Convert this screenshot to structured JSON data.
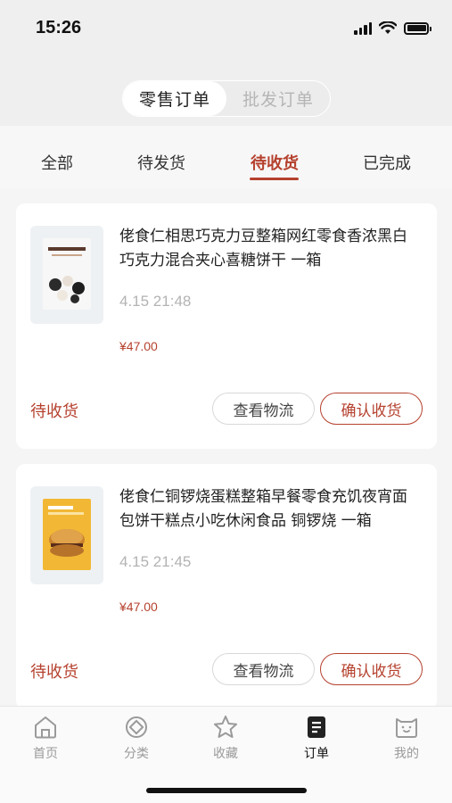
{
  "status_bar": {
    "time": "15:26"
  },
  "segmented": {
    "retail": "零售订单",
    "wholesale": "批发订单"
  },
  "tabs": [
    {
      "label": "全部"
    },
    {
      "label": "待发货"
    },
    {
      "label": "待收货"
    },
    {
      "label": "已完成"
    }
  ],
  "orders": [
    {
      "title": "佬食仁相思巧克力豆整箱网红零食香浓黑白巧克力混合夹心喜糖饼干 一箱",
      "date": "4.15 21:48",
      "price": "¥47.00",
      "status": "待收货",
      "btn_logistics": "查看物流",
      "btn_confirm": "确认收货"
    },
    {
      "title": "佬食仁铜锣烧蛋糕整箱早餐零食充饥夜宵面包饼干糕点小吃休闲食品 铜锣烧 一箱",
      "date": "4.15 21:45",
      "price": "¥47.00",
      "status": "待收货",
      "btn_logistics": "查看物流",
      "btn_confirm": "确认收货"
    }
  ],
  "bottom_nav": [
    {
      "label": "首页",
      "icon": "home-icon"
    },
    {
      "label": "分类",
      "icon": "category-icon"
    },
    {
      "label": "收藏",
      "icon": "star-icon"
    },
    {
      "label": "订单",
      "icon": "order-icon"
    },
    {
      "label": "我的",
      "icon": "profile-icon"
    }
  ],
  "colors": {
    "accent": "#b5412e"
  }
}
